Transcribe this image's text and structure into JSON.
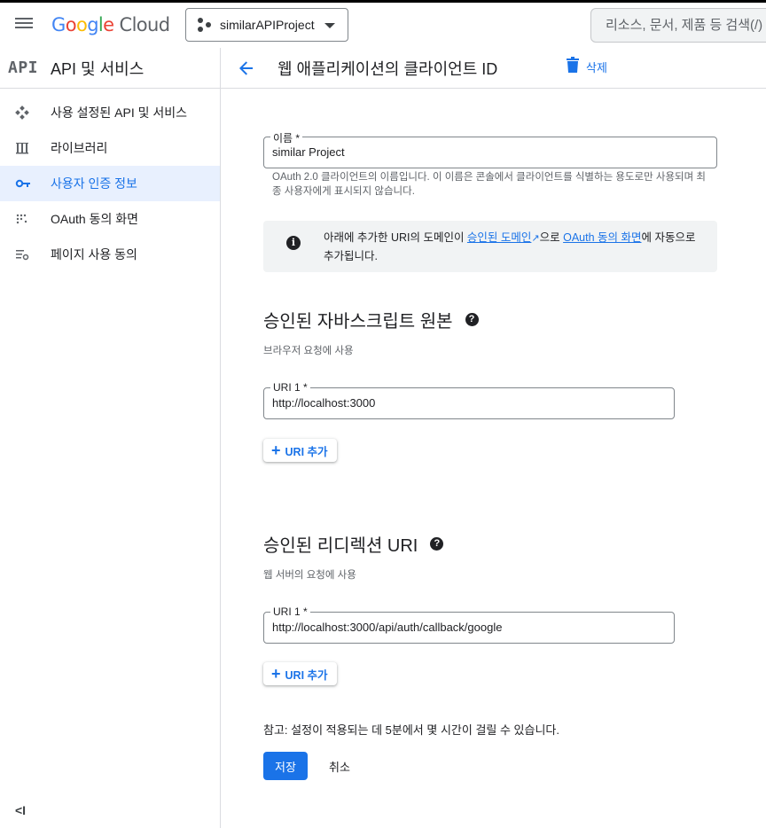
{
  "topbar": {
    "logo_letters": [
      {
        "ch": "G",
        "color": "#4285F4"
      },
      {
        "ch": "o",
        "color": "#EA4335"
      },
      {
        "ch": "o",
        "color": "#FBBC05"
      },
      {
        "ch": "g",
        "color": "#4285F4"
      },
      {
        "ch": "l",
        "color": "#34A853"
      },
      {
        "ch": "e",
        "color": "#EA4335"
      }
    ],
    "logo_suffix": "Cloud",
    "project_name": "similarAPIProject",
    "search_placeholder": "리소스, 문서, 제품 등 검색(/)"
  },
  "sidebar": {
    "logo": "API",
    "title": "API 및 서비스",
    "items": [
      {
        "label": "사용 설정된 API 및 서비스",
        "icon": "api-hub-icon"
      },
      {
        "label": "라이브러리",
        "icon": "library-icon"
      },
      {
        "label": "사용자 인증 정보",
        "icon": "key-icon",
        "active": true
      },
      {
        "label": "OAuth 동의 화면",
        "icon": "consent-icon"
      },
      {
        "label": "페이지 사용 동의",
        "icon": "settings-list-icon"
      }
    ],
    "collapse_label": "<I"
  },
  "header": {
    "title": "웹 애플리케이션의 클라이언트 ID",
    "delete_label": "삭제"
  },
  "form": {
    "name_label": "이름 *",
    "name_value": "similar Project",
    "name_hint": "OAuth 2.0 클라이언트의 이름입니다. 이 이름은 콘솔에서 클라이언트를 식별하는 용도로만 사용되며 최종 사용자에게 표시되지 않습니다.",
    "info": {
      "part1": "아래에 추가한 URI의 도메인이 ",
      "link1": "승인된 도메인",
      "ext_icon": "↗",
      "part2": "으로 ",
      "link2": "OAuth 동의 화면",
      "part3": "에 자동으로 추가됩니다."
    },
    "js_origins": {
      "title": "승인된 자바스크립트 원본",
      "subtitle": "브라우저 요청에 사용",
      "uri_label": "URI 1 *",
      "uri_value": "http://localhost:3000",
      "add_label": "URI 추가"
    },
    "redirect": {
      "title": "승인된 리디렉션 URI",
      "subtitle": "웹 서버의 요청에 사용",
      "uri_label": "URI 1 *",
      "uri_value": "http://localhost:3000/api/auth/callback/google",
      "add_label": "URI 추가"
    },
    "note": "참고: 설정이 적용되는 데 5분에서 몇 시간이 걸릴 수 있습니다.",
    "save_label": "저장",
    "cancel_label": "취소"
  },
  "colors": {
    "accent": "#1a73e8",
    "sidebar_active_bg": "#e8f0fe"
  }
}
